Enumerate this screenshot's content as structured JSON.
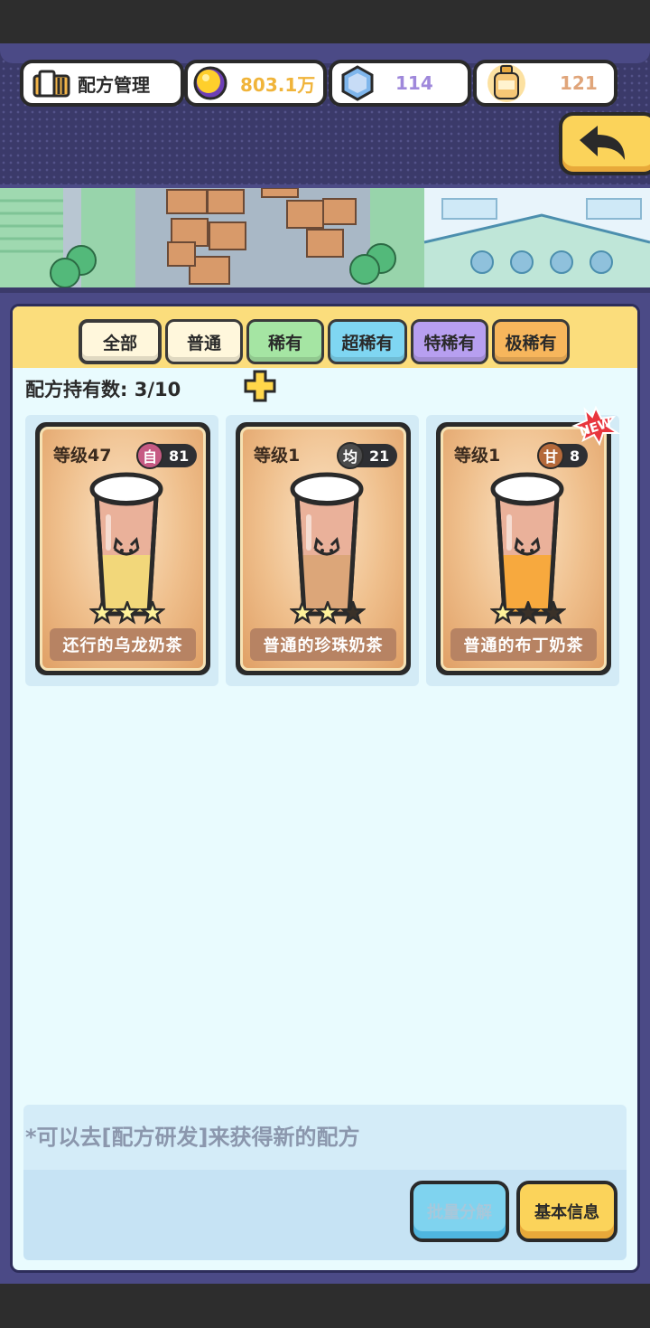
{
  "header": {
    "title": "配方管理",
    "gold": "803.1万",
    "gems": "114",
    "bottles": "121",
    "colors": {
      "gold_text": "#f0b43a",
      "gem_text": "#9f88db",
      "bottle_text": "#e0a57a"
    }
  },
  "tabs": [
    {
      "label": "全部",
      "color": "#fff7dc",
      "active": true
    },
    {
      "label": "普通",
      "color": "#fff7dc"
    },
    {
      "label": "稀有",
      "color": "#a5e5a3"
    },
    {
      "label": "超稀有",
      "color": "#7fd6f2"
    },
    {
      "label": "特稀有",
      "color": "#b79ff0"
    },
    {
      "label": "极稀有",
      "color": "#f7b65c"
    }
  ],
  "count_label": "配方持有数: 3/10",
  "recipes": [
    {
      "level": "等级47",
      "attr": "自",
      "attr_color": "#c65a83",
      "value": "81",
      "stars": 3,
      "max_stars": 3,
      "name": "还行的乌龙奶茶",
      "liquid": "#f2d77a",
      "is_new": false
    },
    {
      "level": "等级1",
      "attr": "均",
      "attr_color": "#4b4b4b",
      "value": "21",
      "stars": 2,
      "max_stars": 3,
      "name": "普通的珍珠奶茶",
      "liquid": "#dca679",
      "is_new": false
    },
    {
      "level": "等级1",
      "attr": "甘",
      "attr_color": "#b5693a",
      "value": "8",
      "stars": 1,
      "max_stars": 3,
      "name": "普通的布丁奶茶",
      "liquid": "#f7a93e",
      "is_new": true,
      "new_label": "NEW"
    }
  ],
  "hint": "*可以去[配方研发]来获得新的配方",
  "buttons": {
    "batch": "批量分解",
    "info": "基本信息"
  },
  "icons": [
    "recipe-book-icon",
    "gold-coin-icon",
    "gem-icon",
    "bottle-icon",
    "back-arrow-icon",
    "plus-icon",
    "star-icon"
  ]
}
